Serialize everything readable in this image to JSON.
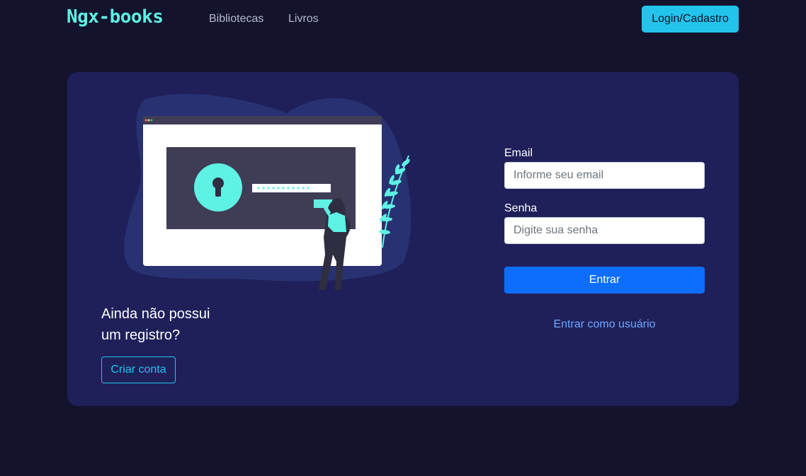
{
  "navbar": {
    "brand": "Ngx-books",
    "links": [
      "Bibliotecas",
      "Livros"
    ],
    "login_button": "Login/Cadastro"
  },
  "register": {
    "text_line1": "Ainda não possui",
    "text_line2": "um registro?",
    "button": "Criar conta"
  },
  "form": {
    "email_label": "Email",
    "email_placeholder": "Informe seu email",
    "password_label": "Senha",
    "password_placeholder": "Digite sua senha",
    "submit_label": "Entrar",
    "guest_link": "Entrar como usuário"
  },
  "colors": {
    "background": "#13132e",
    "card": "#1f205a",
    "accent": "#5ef2e4",
    "cyan_button": "#22c4ec",
    "primary_button": "#0d6efd"
  },
  "illustration": {
    "icon": "keyhole-login-illustration"
  }
}
